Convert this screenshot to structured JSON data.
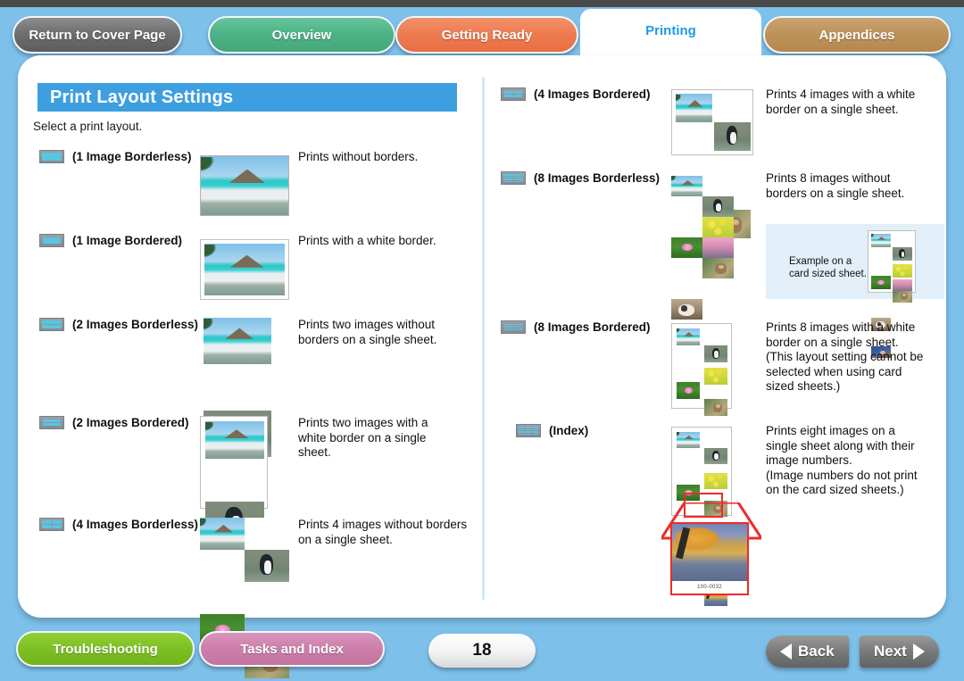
{
  "tabs": [
    {
      "id": "return-to-cover-page",
      "label": "Return to Cover Page",
      "active": false
    },
    {
      "id": "overview",
      "label": "Overview",
      "active": false
    },
    {
      "id": "getting-ready",
      "label": "Getting Ready",
      "active": false
    },
    {
      "id": "printing",
      "label": "Printing",
      "active": true
    },
    {
      "id": "appendices",
      "label": "Appendices",
      "active": false
    }
  ],
  "page": {
    "title": "Print Layout Settings",
    "subtitle": "Select a print layout.",
    "number": "18"
  },
  "left_column": [
    {
      "icon": "layout-1-borderless-icon",
      "label": "(1 Image Borderless)",
      "desc": "Prints without borders."
    },
    {
      "icon": "layout-1-bordered-icon",
      "label": "(1 Image Bordered)",
      "desc": "Prints with a white border."
    },
    {
      "icon": "layout-2-borderless-icon",
      "label": "(2 Images Borderless)",
      "desc": "Prints two images without borders on a single sheet."
    },
    {
      "icon": "layout-2-bordered-icon",
      "label": "(2 Images Bordered)",
      "desc": "Prints two images with a white border on a single sheet."
    },
    {
      "icon": "layout-4-borderless-icon",
      "label": "(4 Images Borderless)",
      "desc": "Prints 4 images without borders on a single sheet."
    }
  ],
  "right_column": [
    {
      "icon": "layout-4-bordered-icon",
      "label": "(4 Images Bordered)",
      "desc": "Prints 4 images with a white border on a single sheet."
    },
    {
      "icon": "layout-8-borderless-icon",
      "label": "(8 Images Borderless)",
      "desc": "Prints 8 images without borders on a single sheet."
    },
    {
      "icon": "layout-8-bordered-icon",
      "label": "(8 Images Bordered)",
      "desc": "Prints 8 images with a white border on a single sheet.\n(This layout setting cannot be selected when using card sized sheets.)"
    },
    {
      "icon": "layout-index-icon",
      "label": "(Index)",
      "desc": "Prints eight images on a single sheet along with their image numbers.\n(Image numbers do not print on the card sized sheets.)"
    }
  ],
  "example_callout": {
    "text": "Example on a\ncard sized sheet."
  },
  "index_callout": {
    "image_number": "100-0032"
  },
  "footer": {
    "troubleshooting": "Troubleshooting",
    "tasks_and_index": "Tasks and Index",
    "back": "Back",
    "next": "Next"
  },
  "colors": {
    "page_background": "#7dc0ea",
    "title_bar": "#3d9fe0",
    "active_tab_text": "#1e9ae8",
    "overview_tab": "#4cb286",
    "getting_ready_tab": "#ee7a4f",
    "appendices_tab": "#bd9259",
    "troubleshooting_button": "#7cc024",
    "tasks_button": "#cc7faa",
    "divider": "#cfe8f8",
    "example_box": "#e2eff9",
    "callout_outline": "#ee2b2b",
    "icon_body": "#868b93",
    "icon_cell": "#57c6e0"
  }
}
